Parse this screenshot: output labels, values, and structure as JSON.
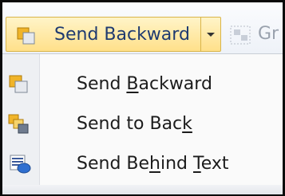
{
  "toolbar": {
    "send_backward_label": "Send Backward",
    "group_label": "Gr"
  },
  "menu": {
    "items": [
      {
        "pre": "Send ",
        "key": "B",
        "post": "ackward",
        "icon": "send-backward-icon"
      },
      {
        "pre": "Send to Bac",
        "key": "k",
        "post": "",
        "icon": "send-to-back-icon"
      },
      {
        "pre": "Send Be",
        "key": "h",
        "post": "ind ",
        "key2": "T",
        "post2": "ext",
        "icon": "send-behind-text-icon"
      }
    ]
  },
  "colors": {
    "highlight_top": "#fff4c8",
    "highlight_bottom": "#ffe08a",
    "highlight_border": "#d9b54a",
    "label_blue": "#1e3a70",
    "gold": "#f0b429",
    "muted": "#9aa2ae"
  }
}
